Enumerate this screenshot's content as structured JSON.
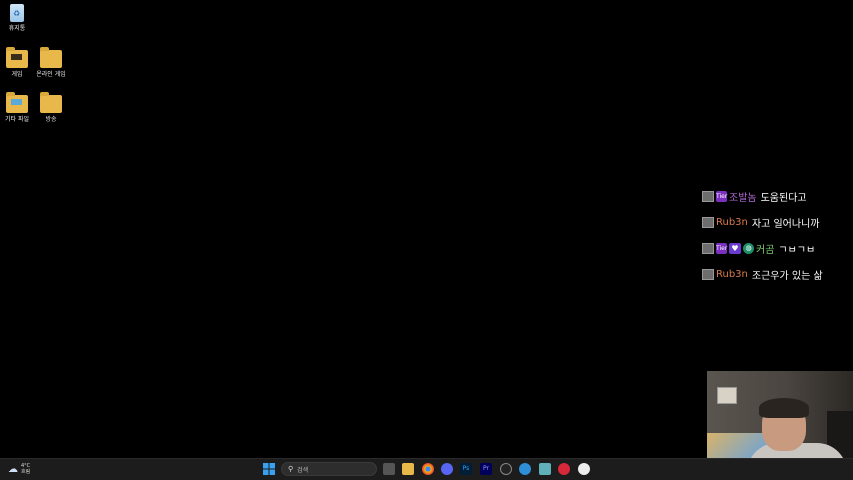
{
  "desktop": {
    "icons": [
      {
        "label": "휴지통"
      },
      {
        "label": "게임"
      },
      {
        "label": "온라인 게임"
      },
      {
        "label": "기타 파일"
      },
      {
        "label": "방송"
      }
    ]
  },
  "chat": {
    "messages": [
      {
        "user": "조발놈",
        "text": "도움된다고"
      },
      {
        "user": "Rub3n",
        "text": "자고 일어나니까"
      },
      {
        "user": "커곰",
        "text": "ㄱㅂㄱㅂ"
      },
      {
        "user": "Rub3n",
        "text": "조근우가 있는 삶"
      }
    ],
    "tier_label": "Tier"
  },
  "taskbar": {
    "weather_temp": "4°C",
    "weather_desc": "흐림",
    "search_placeholder": "검색",
    "apps": [
      "start-icon",
      "search",
      "task-view-icon",
      "file-explorer-icon",
      "chrome-icon",
      "discord-icon",
      "photoshop-icon",
      "premiere-icon",
      "obs-icon",
      "browser-icon",
      "notepad-icon",
      "app-red-icon",
      "app-white-icon"
    ],
    "ps_label": "Ps",
    "pr_label": "Pr"
  }
}
